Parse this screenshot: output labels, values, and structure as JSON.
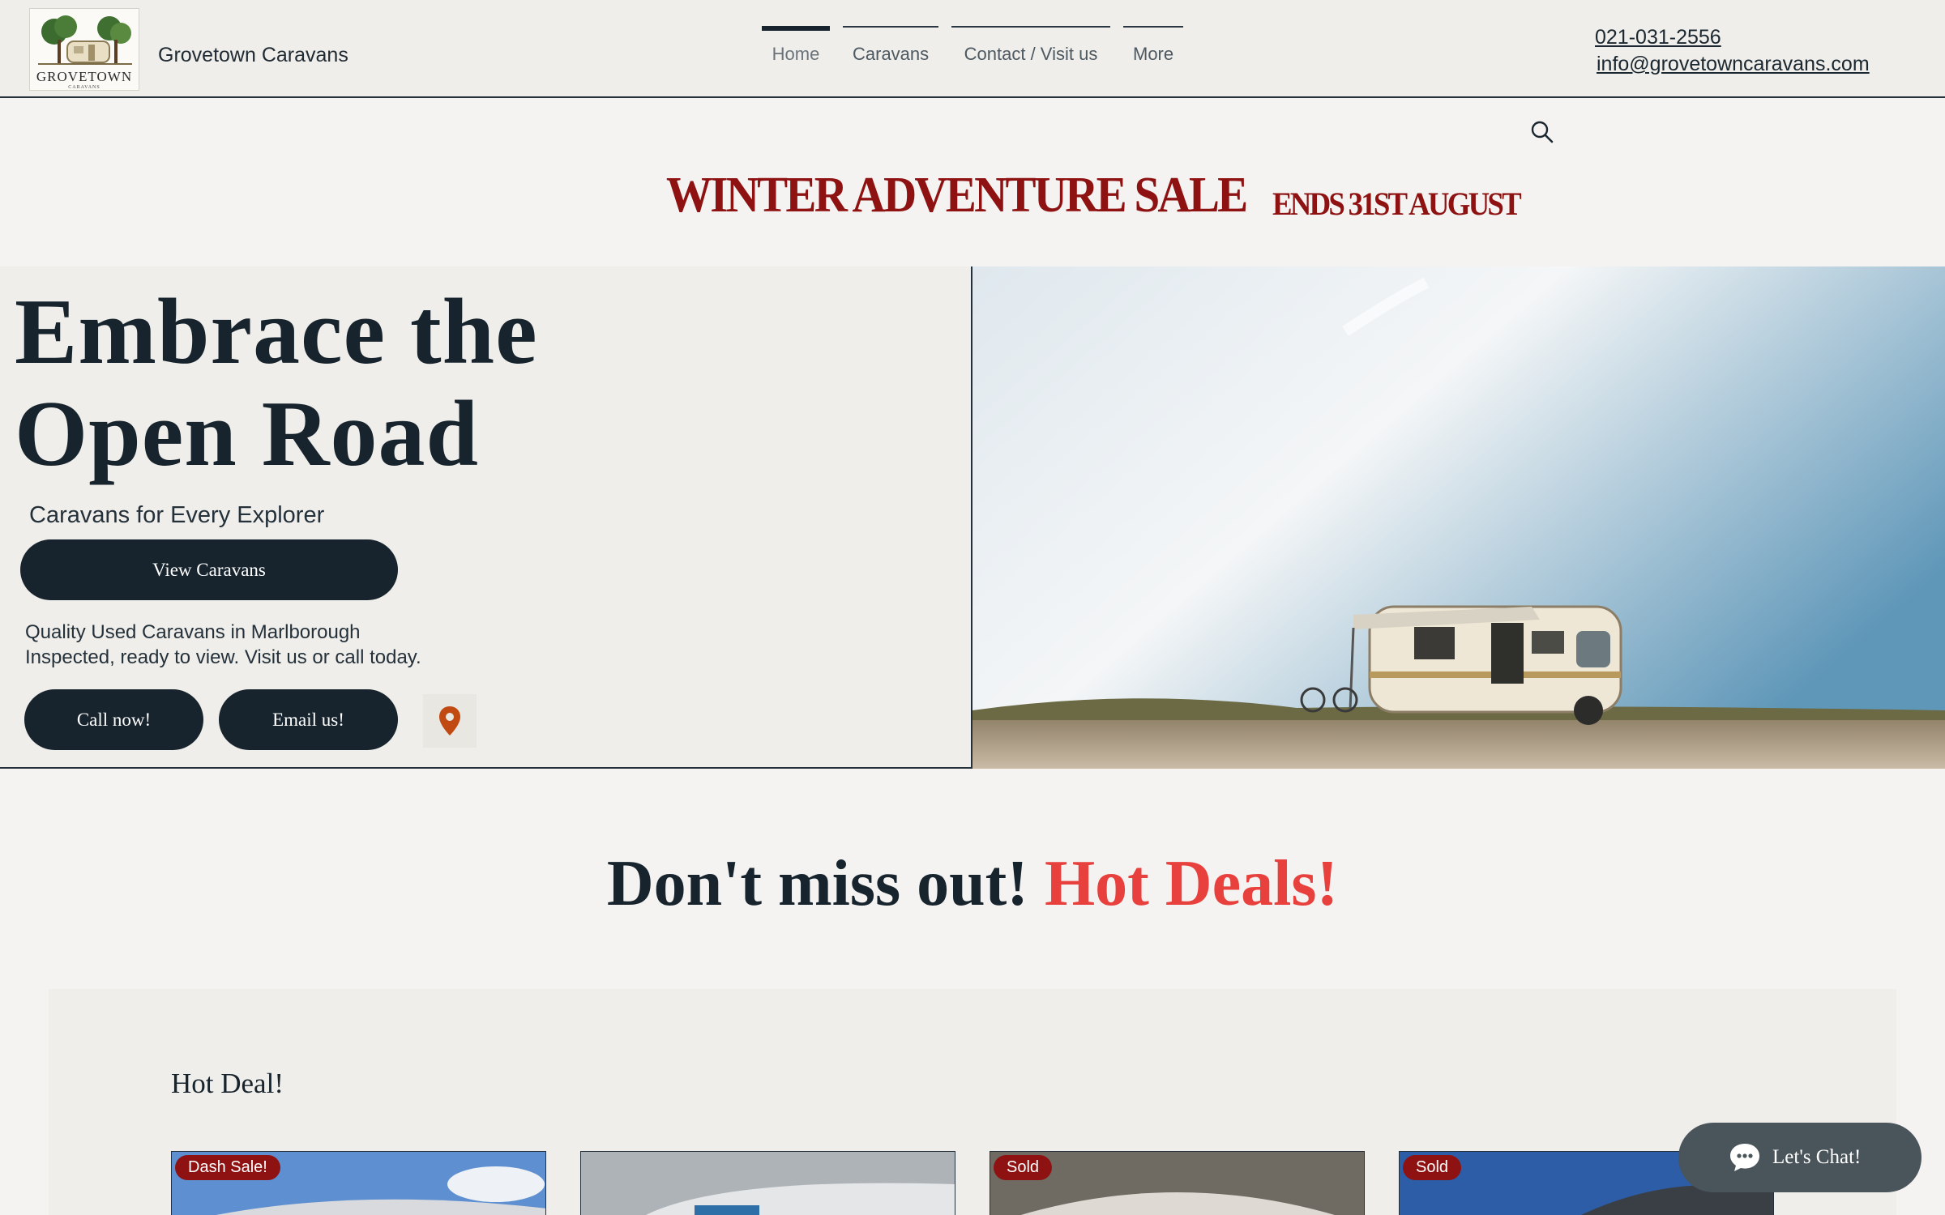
{
  "header": {
    "logo_brand": "GROVETOWN",
    "logo_sub": "CARAVANS",
    "site_name": "Grovetown Caravans",
    "nav": [
      {
        "label": "Home",
        "active": true
      },
      {
        "label": "Caravans"
      },
      {
        "label": "Contact / Visit us"
      },
      {
        "label": "More"
      }
    ],
    "phone": "021-031-2556",
    "email": "info@grovetowncaravans.com"
  },
  "banner": {
    "sale_title": "WINTER ADVENTURE SALE",
    "sale_ends": "ENDS 31ST AUGUST"
  },
  "hero": {
    "title_line1": "Embrace the",
    "title_line2": "Open Road",
    "subtitle": "Caravans for Every Explorer",
    "view_button": "View Caravans",
    "desc_line1": "Quality Used Caravans in Marlborough",
    "desc_line2": "Inspected, ready to view. Visit us or call today.",
    "call_button": "Call now!",
    "email_button": "Email us!"
  },
  "deals": {
    "heading_part1": "Don't miss out!",
    "heading_part2": "Hot Deals!",
    "section_label": "Hot Deal!",
    "cards": [
      {
        "badge": "Dash Sale!"
      },
      {
        "badge": ""
      },
      {
        "badge": "Sold"
      },
      {
        "badge": "Sold"
      }
    ]
  },
  "chat": {
    "label": "Let's Chat!"
  },
  "colors": {
    "accent_red": "#8e1212",
    "hot_red": "#e8413d",
    "dark": "#17242d"
  }
}
